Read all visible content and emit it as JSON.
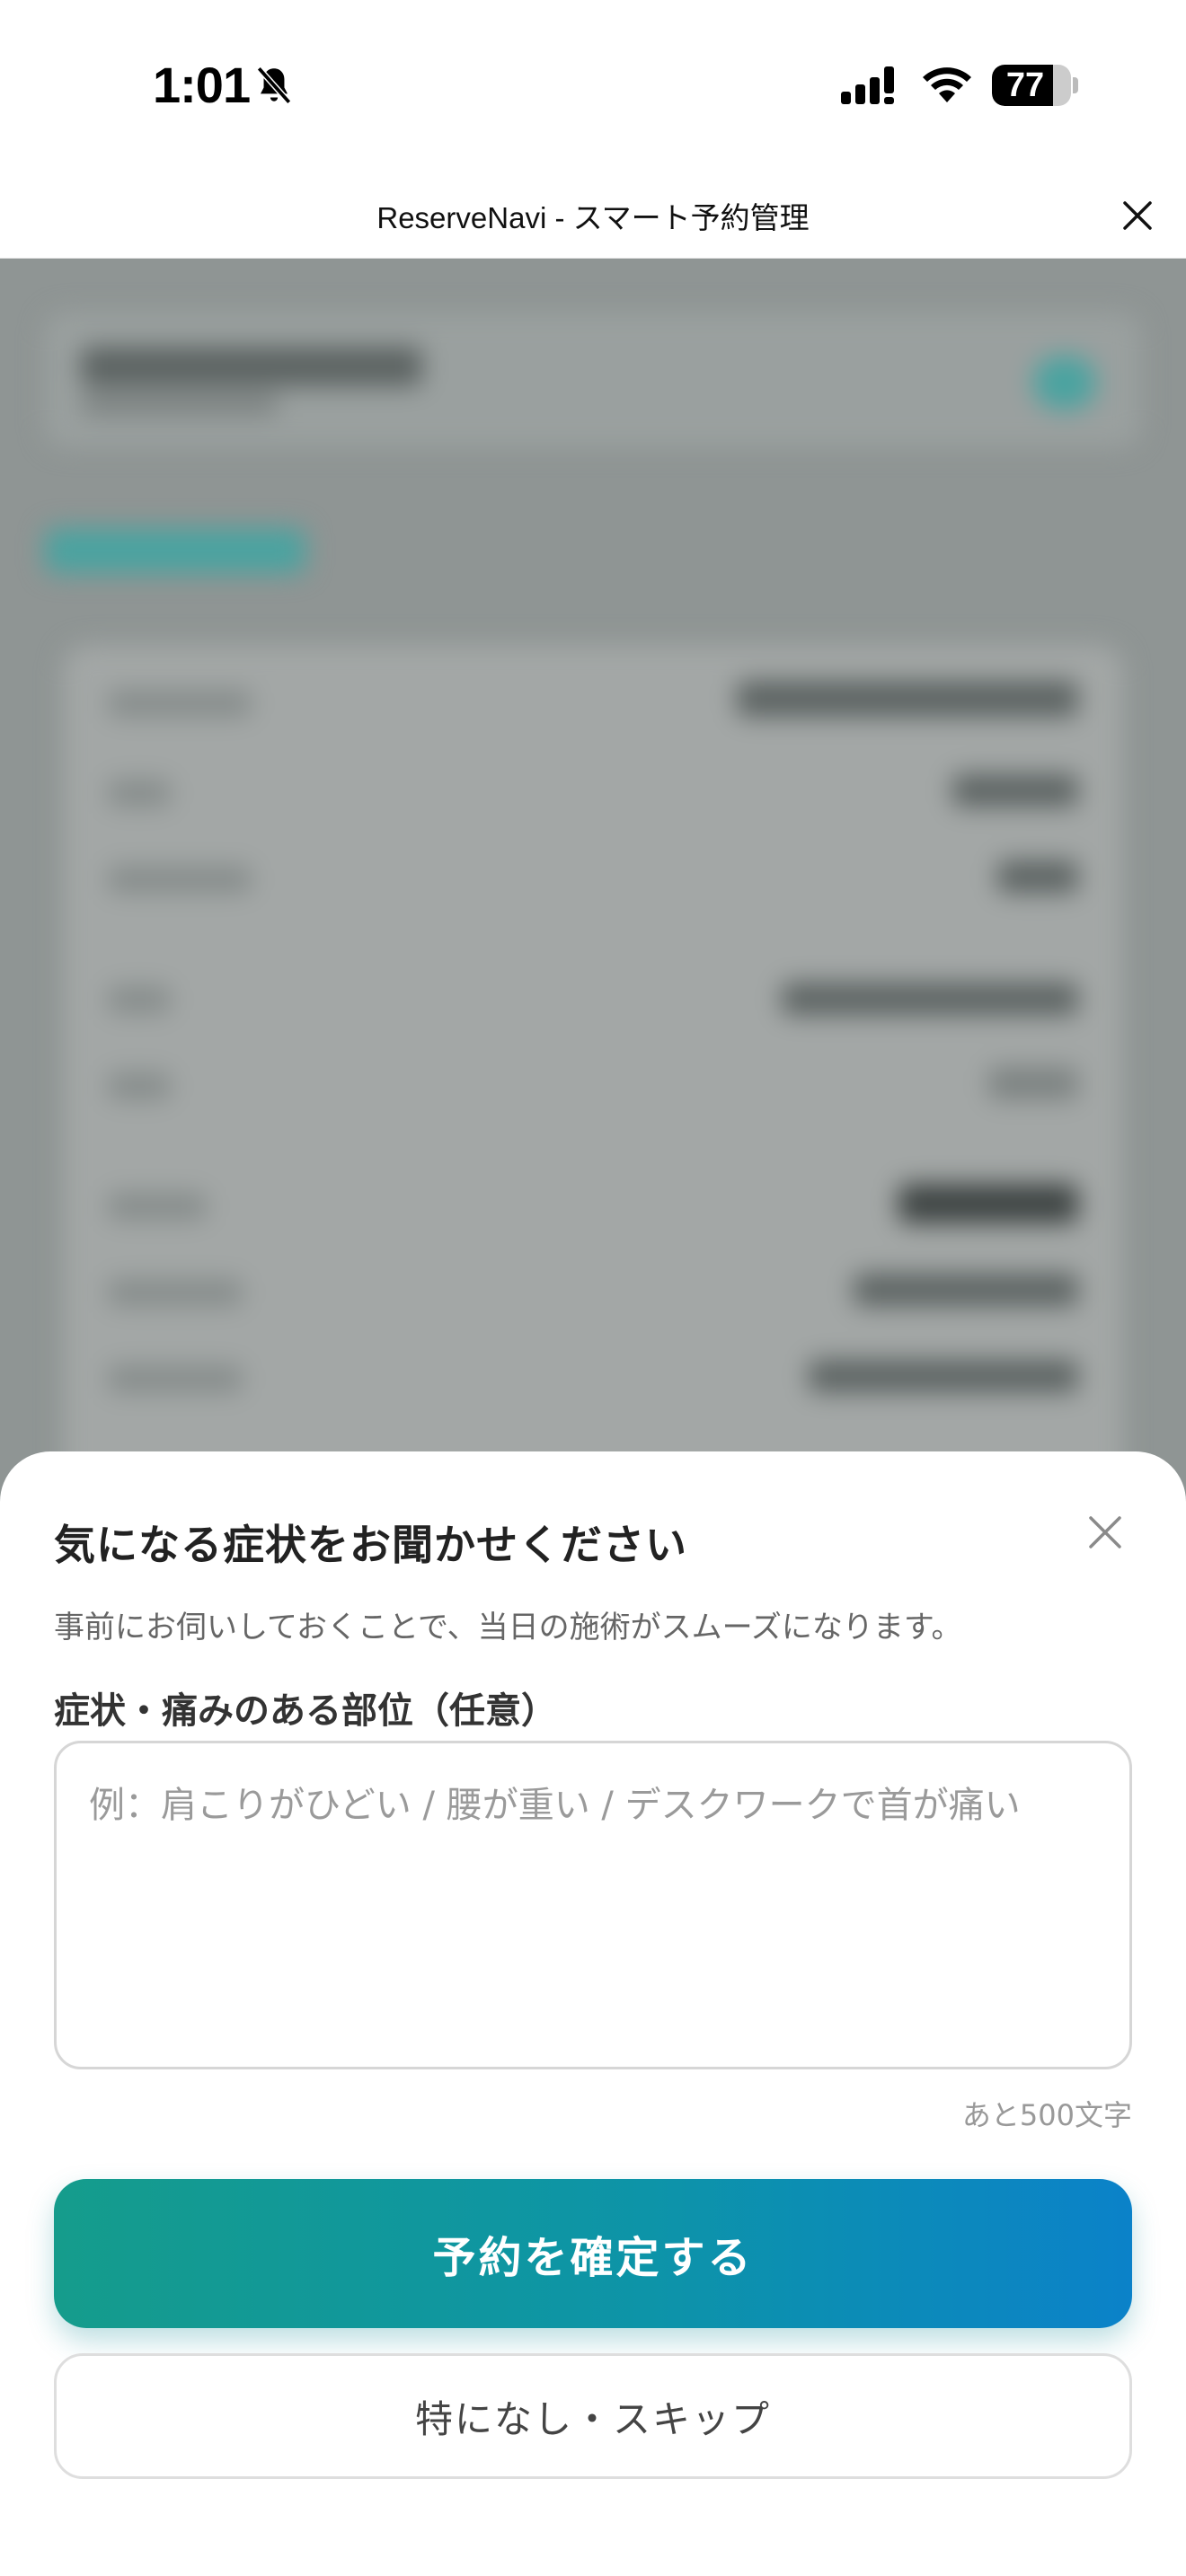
{
  "status_bar": {
    "time": "1:01",
    "battery_level": "77",
    "icons": [
      "bell-slash-icon",
      "signal-icon",
      "wifi-icon",
      "battery-icon"
    ]
  },
  "header": {
    "title": "ReserveNavi - スマート予約管理",
    "close_icon": "close-icon"
  },
  "sheet": {
    "title": "気になる症状をお聞かせください",
    "description": "事前にお伺いしておくことで、当日の施術がスムーズになります。",
    "field_label": "症状・痛みのある部位（任意）",
    "textarea_value": "",
    "textarea_placeholder": "例：肩こりがひどい / 腰が重い / デスクワークで首が痛い",
    "char_count": "あと500文字",
    "confirm_label": "予約を確定する",
    "skip_label": "特になし・スキップ",
    "close_icon": "close-icon"
  },
  "colors": {
    "accent_start": "#159c8c",
    "accent_end": "#0b82c9",
    "scrim": "#8f9594"
  }
}
